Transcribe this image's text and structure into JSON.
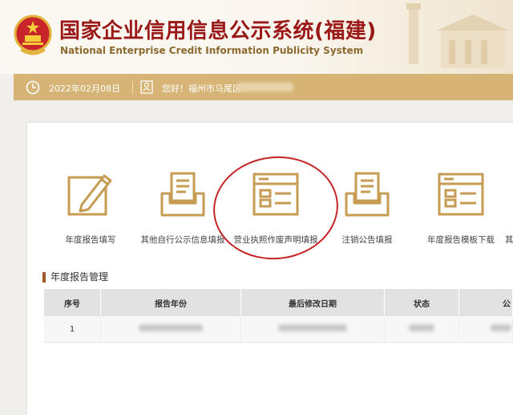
{
  "header": {
    "title_cn": "国家企业信用信息公示系统(福建)",
    "title_en": "National Enterprise Credit Information Publicity System"
  },
  "infobar": {
    "date": "2022年02月08日",
    "greeting": "您好！福州市马尾区"
  },
  "functions": [
    {
      "label": "年度报告填写",
      "icon": "pencil-edit-icon"
    },
    {
      "label": "其他自行公示信息填报",
      "icon": "inbox-document-icon"
    },
    {
      "label": "营业执照作废声明填报",
      "icon": "license-card-icon"
    },
    {
      "label": "注销公告填报",
      "icon": "inbox-document-icon"
    },
    {
      "label": "年度报告模板下载",
      "icon": "license-card-icon"
    },
    {
      "label": "其",
      "icon": ""
    }
  ],
  "section": {
    "title": "年度报告管理"
  },
  "table": {
    "headers": [
      "序号",
      "报告年份",
      "最后修改日期",
      "状态",
      "公"
    ],
    "rows": [
      {
        "index": "1"
      }
    ]
  },
  "colors": {
    "title_red": "#9a1818",
    "gold_bar": "#d6b476",
    "icon_gold": "#c69b52",
    "highlight_circle": "#c62424"
  }
}
